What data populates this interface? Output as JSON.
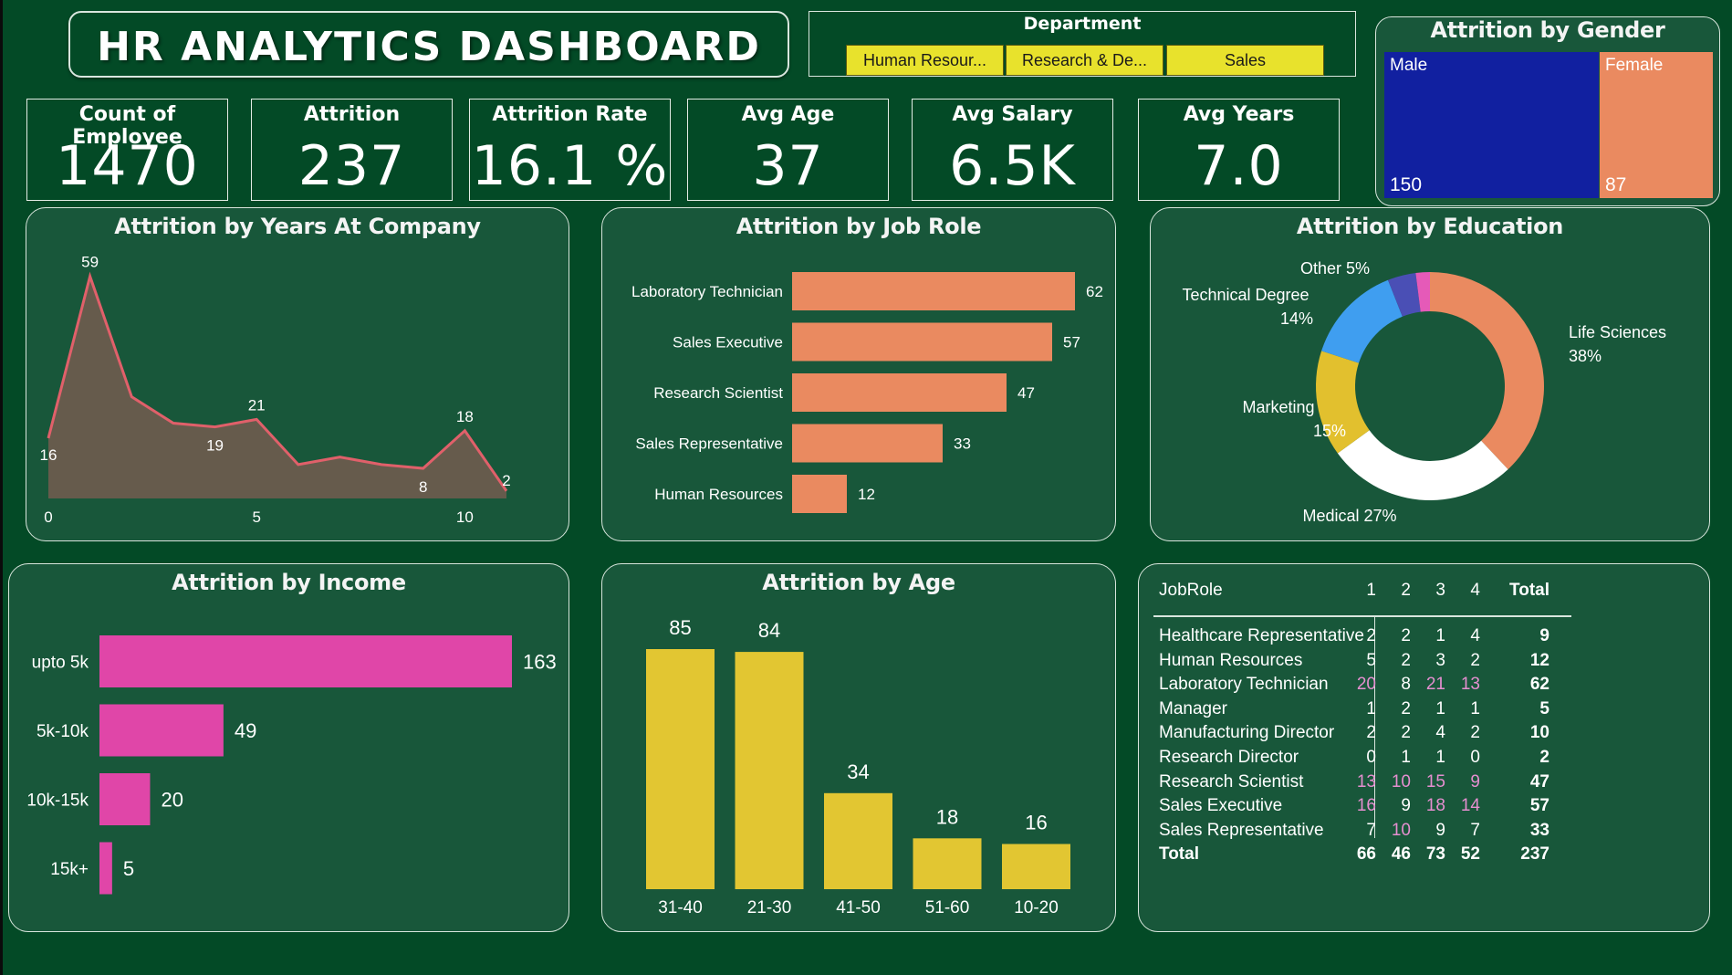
{
  "title": "HR ANALYTICS DASHBOARD",
  "department": {
    "title": "Department",
    "options": [
      "Human Resour...",
      "Research & De...",
      "Sales"
    ]
  },
  "kpis": [
    {
      "label": "Count of Employee",
      "value": "1470"
    },
    {
      "label": "Attrition",
      "value": "237"
    },
    {
      "label": "Attrition Rate",
      "value": "16.1 %"
    },
    {
      "label": "Avg Age",
      "value": "37"
    },
    {
      "label": "Avg Salary",
      "value": "6.5K"
    },
    {
      "label": "Avg Years",
      "value": "7.0"
    }
  ],
  "gender": {
    "title": "Attrition by Gender",
    "male_label": "Male",
    "male_value": "150",
    "male_color": "#1120a0",
    "female_label": "Female",
    "female_value": "87",
    "female_color": "#ea8a60"
  },
  "years_chart": {
    "title": "Attrition by Years At Company",
    "chart_data": {
      "type": "area",
      "x": [
        0,
        1,
        2,
        3,
        4,
        5,
        6,
        7,
        8,
        9,
        10,
        11
      ],
      "y": [
        16,
        59,
        27,
        20,
        19,
        21,
        9,
        11,
        9,
        8,
        18,
        2
      ],
      "labeled_points": [
        0,
        1,
        5,
        4,
        10,
        9,
        11
      ],
      "x_ticks": [
        "0",
        "5",
        "10"
      ],
      "x_tick_values": [
        0,
        5,
        10
      ],
      "ylim": [
        0,
        65
      ],
      "line_color": "#e0606a",
      "fill_color": "#665b4c"
    }
  },
  "jobrole_chart": {
    "title": "Attrition by Job Role",
    "chart_data": {
      "type": "bar",
      "orientation": "horizontal",
      "categories": [
        "Laboratory Technician",
        "Sales Executive",
        "Research Scientist",
        "Sales Representative",
        "Human Resources"
      ],
      "values": [
        62,
        57,
        47,
        33,
        12
      ],
      "xlim": [
        0,
        62
      ],
      "color": "#ea8a60"
    }
  },
  "education_chart": {
    "title": "Attrition by Education",
    "chart_data": {
      "type": "pie",
      "donut": true,
      "slices": [
        {
          "name": "Life Sciences",
          "pct": "38%",
          "value": 38,
          "color": "#ea8a60"
        },
        {
          "name": "Medical",
          "pct": "27%",
          "value": 27,
          "color": "#ffffff"
        },
        {
          "name": "Marketing",
          "pct": "15%",
          "value": 15,
          "color": "#e2c02e"
        },
        {
          "name": "Technical Degree",
          "pct": "14%",
          "value": 14,
          "color": "#3f9ef0"
        },
        {
          "name": "Other",
          "pct": "5%",
          "value": 4,
          "color": "#4a4fb5"
        },
        {
          "name": "",
          "pct": "",
          "value": 2,
          "color": "#e55ab8"
        }
      ]
    }
  },
  "income_chart": {
    "title": "Attrition by Income",
    "chart_data": {
      "type": "bar",
      "orientation": "horizontal",
      "categories": [
        "upto 5k",
        "5k-10k",
        "10k-15k",
        "15k+"
      ],
      "values": [
        163,
        49,
        20,
        5
      ],
      "xlim": [
        0,
        163
      ],
      "color": "#e046a8"
    }
  },
  "age_chart": {
    "title": "Attrition by Age",
    "chart_data": {
      "type": "bar",
      "categories": [
        "31-40",
        "21-30",
        "41-50",
        "51-60",
        "10-20"
      ],
      "values": [
        85,
        84,
        34,
        18,
        16
      ],
      "ylim": [
        0,
        85
      ],
      "color": "#e2c632"
    }
  },
  "matrix": {
    "headers": [
      "JobRole",
      "1",
      "2",
      "3",
      "4",
      "Total"
    ],
    "rows": [
      {
        "role": "Healthcare Representative",
        "v": [
          "2",
          "2",
          "1",
          "4"
        ],
        "total": "9",
        "hl": [
          false,
          false,
          false,
          false
        ]
      },
      {
        "role": "Human Resources",
        "v": [
          "5",
          "2",
          "3",
          "2"
        ],
        "total": "12",
        "hl": [
          false,
          false,
          false,
          false
        ]
      },
      {
        "role": "Laboratory Technician",
        "v": [
          "20",
          "8",
          "21",
          "13"
        ],
        "total": "62",
        "hl": [
          true,
          false,
          true,
          true
        ]
      },
      {
        "role": "Manager",
        "v": [
          "1",
          "2",
          "1",
          "1"
        ],
        "total": "5",
        "hl": [
          false,
          false,
          false,
          false
        ]
      },
      {
        "role": "Manufacturing Director",
        "v": [
          "2",
          "2",
          "4",
          "2"
        ],
        "total": "10",
        "hl": [
          false,
          false,
          false,
          false
        ]
      },
      {
        "role": "Research Director",
        "v": [
          "0",
          "1",
          "1",
          "0"
        ],
        "total": "2",
        "hl": [
          false,
          false,
          false,
          false
        ]
      },
      {
        "role": "Research Scientist",
        "v": [
          "13",
          "10",
          "15",
          "9"
        ],
        "total": "47",
        "hl": [
          true,
          true,
          true,
          true
        ]
      },
      {
        "role": "Sales Executive",
        "v": [
          "16",
          "9",
          "18",
          "14"
        ],
        "total": "57",
        "hl": [
          true,
          false,
          true,
          true
        ]
      },
      {
        "role": "Sales Representative",
        "v": [
          "7",
          "10",
          "9",
          "7"
        ],
        "total": "33",
        "hl": [
          false,
          true,
          false,
          false
        ]
      }
    ],
    "totals": {
      "label": "Total",
      "v": [
        "66",
        "46",
        "73",
        "52"
      ],
      "total": "237"
    },
    "highlight_color": "#e58fd0"
  }
}
